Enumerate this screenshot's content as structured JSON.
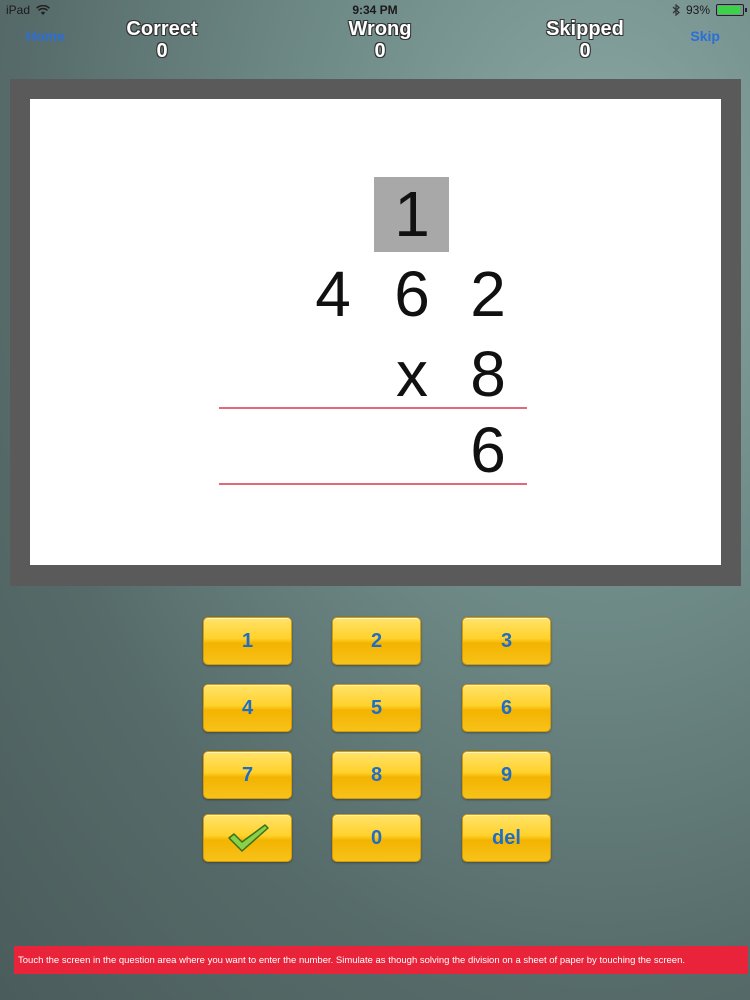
{
  "status": {
    "carrier": "iPad",
    "time": "9:34 PM",
    "battery": "93%",
    "battery_level": 0.93
  },
  "header": {
    "home_label": "Home",
    "skip_label": "Skip",
    "correct_label": "Correct",
    "correct_value": "0",
    "wrong_label": "Wrong",
    "wrong_value": "0",
    "skipped_label": "Skipped",
    "skipped_value": "0"
  },
  "problem": {
    "carry": "1",
    "multiplicand": [
      "4",
      "6",
      "2"
    ],
    "operator": "x",
    "multiplier": "8",
    "answer": [
      "6"
    ]
  },
  "keypad": {
    "k1": "1",
    "k2": "2",
    "k3": "3",
    "k4": "4",
    "k5": "5",
    "k6": "6",
    "k7": "7",
    "k8": "8",
    "k9": "9",
    "k0": "0",
    "del": "del",
    "check_icon": "check-icon"
  },
  "instruction": "Touch the screen in the question area where you want to enter the number. Simulate as though solving the division on a sheet of paper by touching the screen."
}
